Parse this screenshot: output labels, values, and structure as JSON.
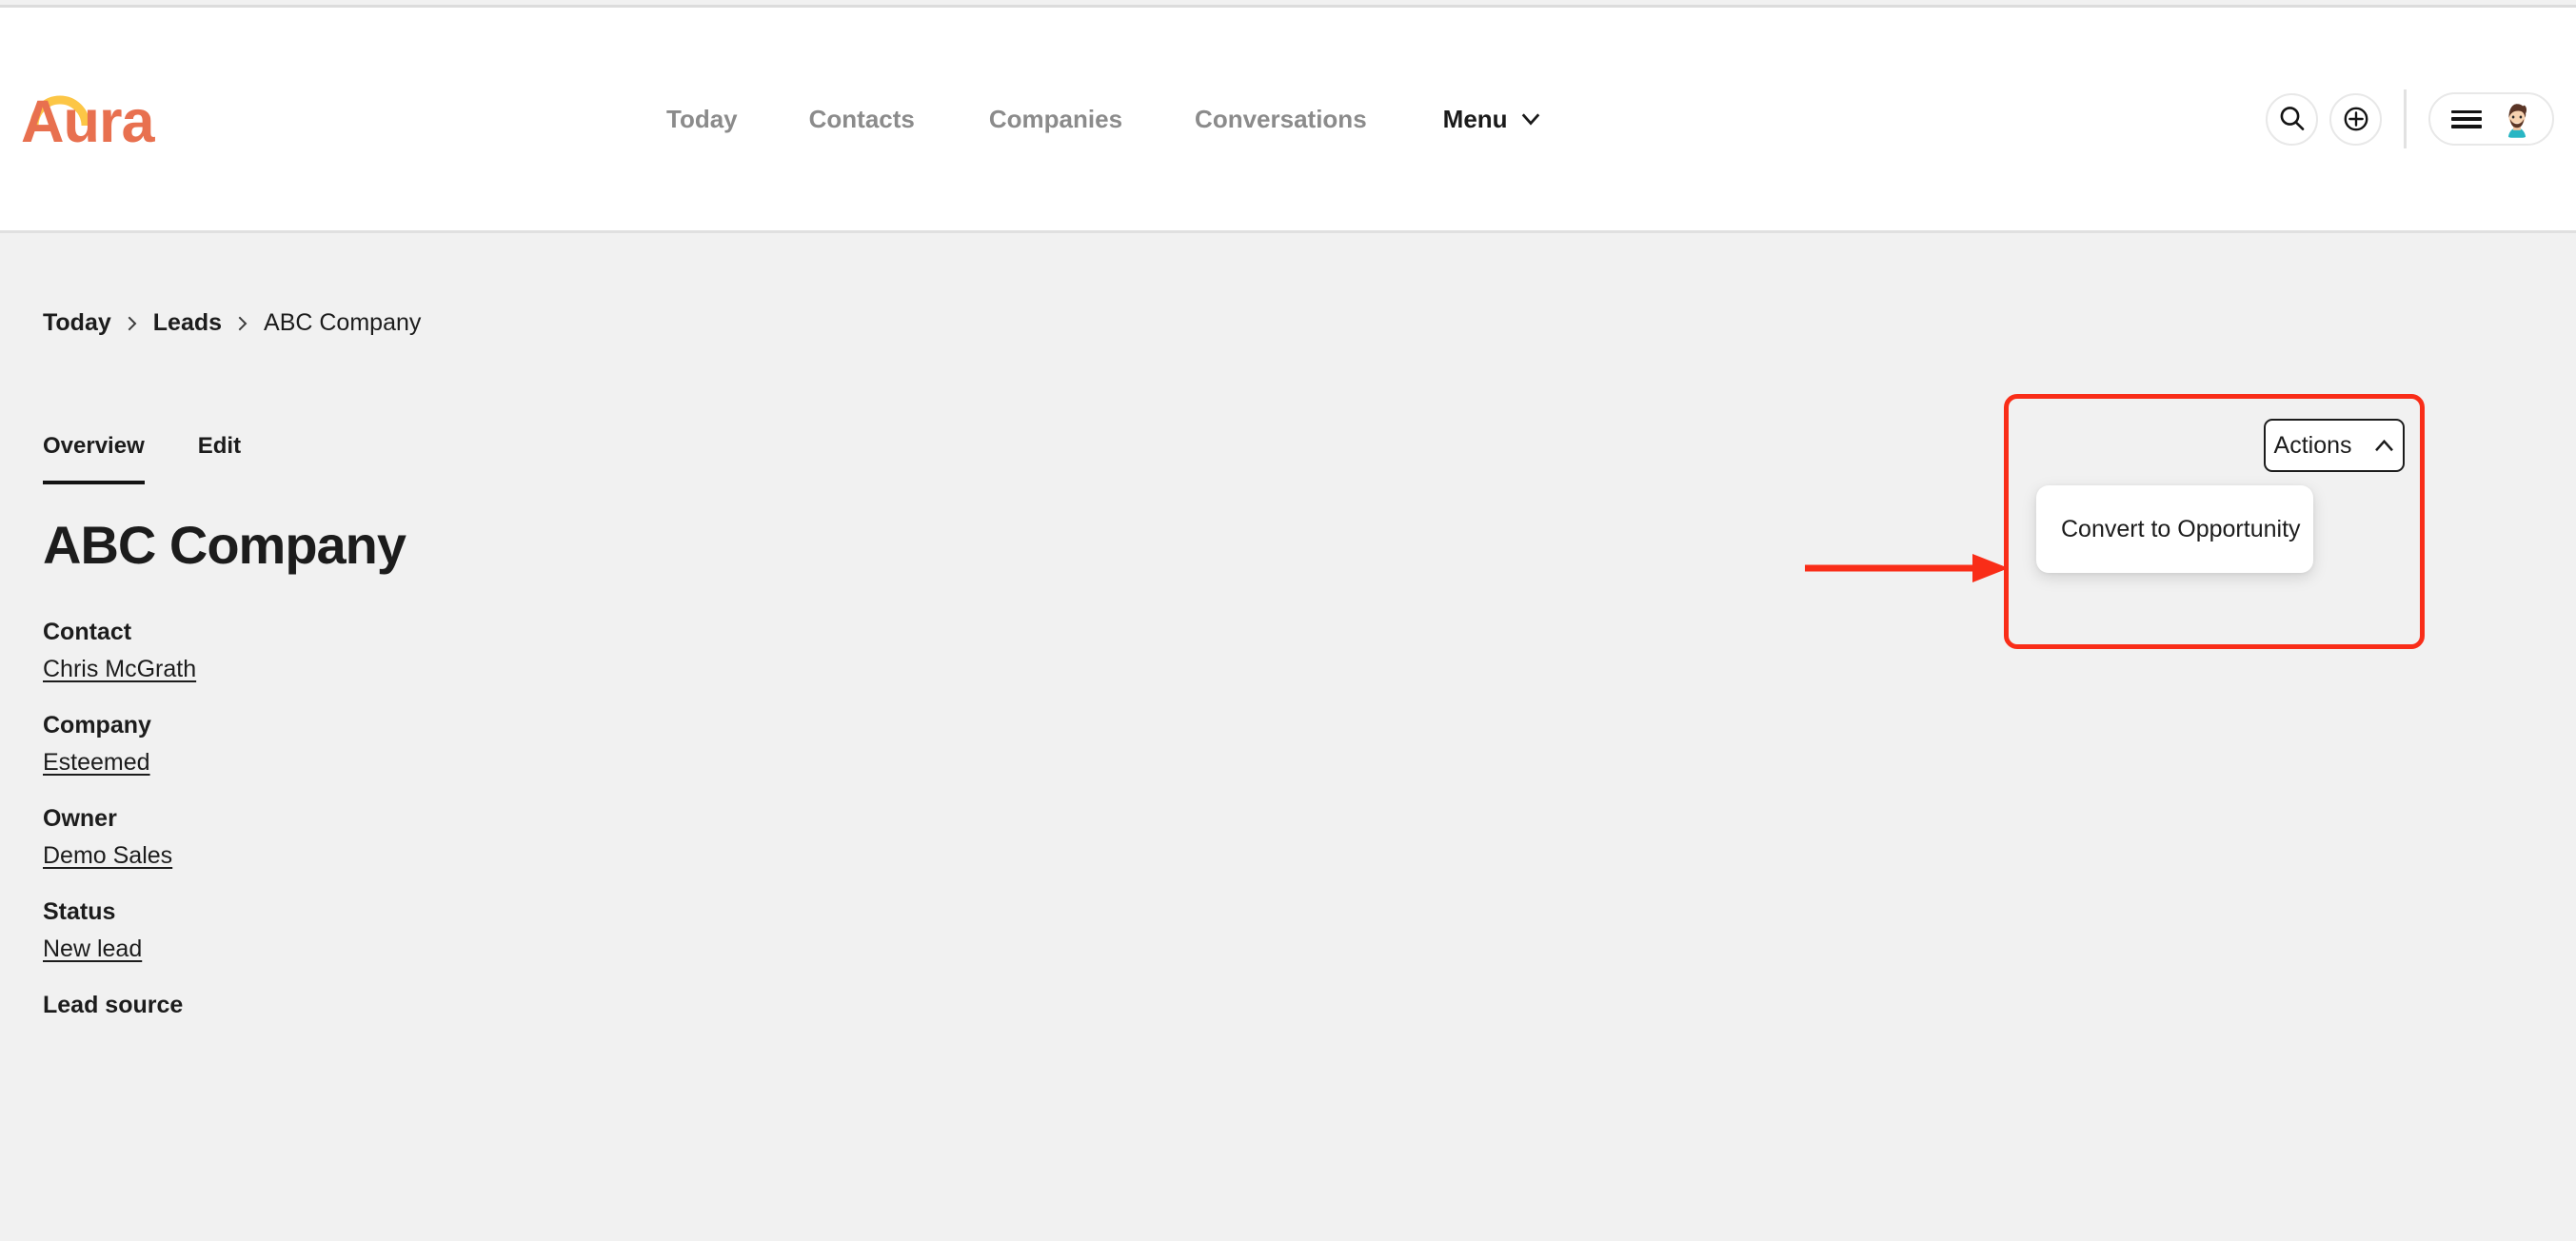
{
  "brand": {
    "name": "Aura",
    "text_color": "#e8704f",
    "arc_color": "#fcc646",
    "logo_icon": "aura-arc-logo"
  },
  "header": {
    "nav_items": [
      {
        "label": "Today",
        "active": false
      },
      {
        "label": "Contacts",
        "active": false
      },
      {
        "label": "Companies",
        "active": false
      },
      {
        "label": "Conversations",
        "active": false
      },
      {
        "label": "Menu",
        "active": true
      }
    ],
    "icons": {
      "search": "search-icon",
      "add": "plus-circle-icon",
      "hamburger": "hamburger-menu-icon",
      "avatar": "user-avatar"
    }
  },
  "breadcrumb": {
    "items": [
      {
        "label": "Today",
        "strong": true
      },
      {
        "label": "Leads",
        "strong": true
      },
      {
        "label": "ABC Company",
        "strong": false
      }
    ],
    "separator_icon": "chevron-right-icon"
  },
  "tabs": [
    {
      "label": "Overview",
      "active": true
    },
    {
      "label": "Edit",
      "active": false
    }
  ],
  "record": {
    "title": "ABC Company",
    "fields": [
      {
        "label": "Contact",
        "value": "Chris McGrath",
        "link": true
      },
      {
        "label": "Company",
        "value": "Esteemed",
        "link": true
      },
      {
        "label": "Owner",
        "value": "Demo Sales",
        "link": true
      },
      {
        "label": "Status",
        "value": "New lead",
        "link": true
      },
      {
        "label": "Lead source",
        "value": "",
        "link": false
      }
    ]
  },
  "actions": {
    "button_label": "Actions",
    "button_icon": "chevron-up-icon",
    "expanded": true,
    "menu_items": [
      {
        "label": "Convert to Opportunity"
      }
    ]
  },
  "annotations": {
    "highlight_color": "#f92d18",
    "arrow_icon": "right-arrow-annotation",
    "rect_icon": "highlight-rectangle-annotation"
  },
  "colors": {
    "page_background": "#f1f1f1",
    "header_background": "#ffffff",
    "text_primary": "#1c1c1c",
    "text_muted": "#8b8b8b",
    "accent": "#e8704f"
  }
}
